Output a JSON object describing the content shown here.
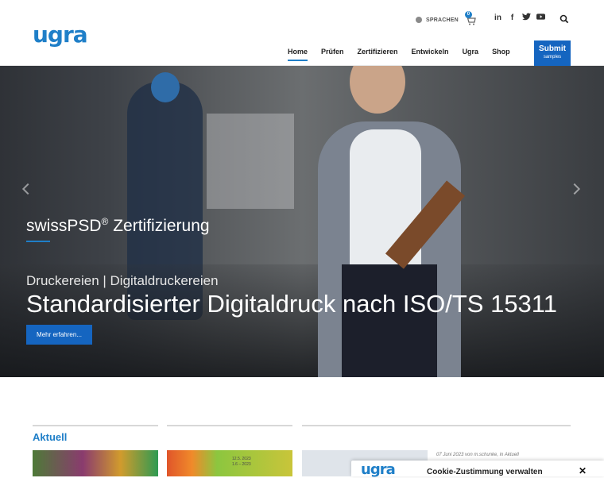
{
  "header": {
    "logo": "ugra",
    "language_label": "SPRACHEN",
    "cart_count": "0",
    "social": [
      {
        "icon": "linkedin-icon",
        "glyph": "in"
      },
      {
        "icon": "facebook-icon",
        "glyph": "f"
      },
      {
        "icon": "twitter-icon",
        "glyph": "t"
      },
      {
        "icon": "youtube-icon",
        "glyph": "▶"
      }
    ],
    "search_icon": "search-icon",
    "nav": [
      "Home",
      "Prüfen",
      "Zertifizieren",
      "Entwickeln",
      "Ugra",
      "Shop"
    ],
    "active_nav": "Home",
    "submit_line1": "Submit",
    "submit_line2": "samples"
  },
  "hero": {
    "title": "swissPSD",
    "title_sup": "®",
    "title_rest": " Zertifizierung",
    "subtitle": "Druckereien | Digitaldruckereien",
    "headline": "Standardisierter Digitaldruck nach ISO/TS 15311",
    "button": "Mehr erfahren..."
  },
  "news": {
    "heading": "Aktuell",
    "thumb2_label": "12.5. 2023\n1.6 – 2023",
    "meta": "07 Juni 2023 von m.schunke, in Aktuell"
  },
  "cookie": {
    "logo": "ugra",
    "title": "Cookie-Zustimmung verwalten",
    "close": "✕"
  },
  "colors": {
    "brand_blue": "#1f7fc8",
    "button_blue": "#1565c0"
  }
}
